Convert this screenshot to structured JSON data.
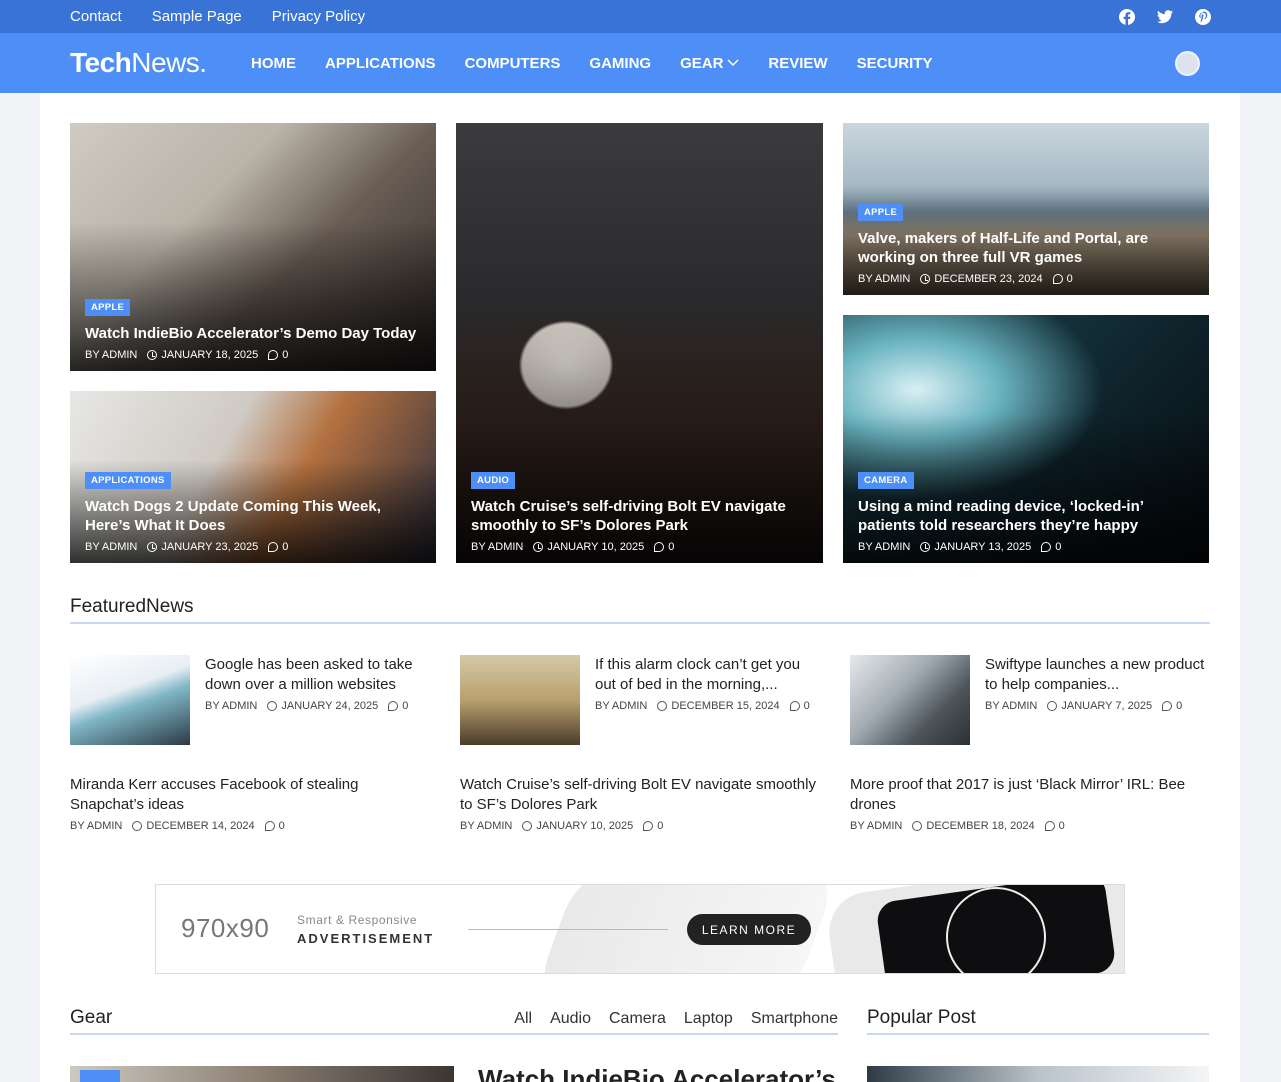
{
  "topbar": {
    "links": [
      "Contact",
      "Sample Page",
      "Privacy Policy"
    ],
    "social": [
      "facebook-icon",
      "twitter-icon",
      "pinterest-icon"
    ]
  },
  "nav": {
    "logo_bold": "Tech",
    "logo_light": "News.",
    "menu": [
      "HOME",
      "APPLICATIONS",
      "COMPUTERS",
      "GAMING",
      "GEAR",
      "REVIEW",
      "SECURITY"
    ]
  },
  "hero": [
    {
      "tag": "APPLE",
      "title": "Watch IndieBio Accelerator’s Demo Day Today",
      "author": "BY ADMIN",
      "date": "JANUARY 18, 2025",
      "comments": "0"
    },
    {
      "tag": "APPLICATIONS",
      "title": "Watch Dogs 2 Update Coming This Week, Here’s What It Does",
      "author": "BY ADMIN",
      "date": "JANUARY 23, 2025",
      "comments": "0"
    },
    {
      "tag": "AUDIO",
      "title": "Watch Cruise’s self-driving Bolt EV navigate smoothly to SF’s Dolores Park",
      "author": "BY ADMIN",
      "date": "JANUARY 10, 2025",
      "comments": "0"
    },
    {
      "tag": "APPLE",
      "title": "Valve, makers of Half-Life and Portal, are working on three full VR games",
      "author": "BY ADMIN",
      "date": "DECEMBER 23, 2024",
      "comments": "0"
    },
    {
      "tag": "CAMERA",
      "title": "Using a mind reading device, ‘locked-in’ patients told researchers they’re happy",
      "author": "BY ADMIN",
      "date": "JANUARY 13, 2025",
      "comments": "0"
    }
  ],
  "featured": {
    "heading": "FeaturedNews",
    "items": [
      {
        "title": "Google has been asked to take down over a million websites",
        "author": "BY ADMIN",
        "date": "JANUARY 24, 2025",
        "comments": "0"
      },
      {
        "title": "If this alarm clock can’t get you out of bed in the morning,...",
        "author": "BY ADMIN",
        "date": "DECEMBER 15, 2024",
        "comments": "0"
      },
      {
        "title": "Swiftype launches a new product to help companies...",
        "author": "BY ADMIN",
        "date": "JANUARY 7, 2025",
        "comments": "0"
      },
      {
        "title": "Miranda Kerr accuses Facebook of stealing Snapchat’s ideas",
        "author": "BY ADMIN",
        "date": "DECEMBER 14, 2024",
        "comments": "0"
      },
      {
        "title": "Watch Cruise’s self-driving Bolt EV navigate smoothly to SF’s Dolores Park",
        "author": "BY ADMIN",
        "date": "JANUARY 10, 2025",
        "comments": "0"
      },
      {
        "title": "More proof that 2017 is just ‘Black Mirror’ IRL: Bee drones",
        "author": "BY ADMIN",
        "date": "DECEMBER 18, 2024",
        "comments": "0"
      }
    ]
  },
  "ad": {
    "size": "970x90",
    "line1": "Smart & Responsive",
    "line2": "ADVERTISEMENT",
    "button": "LEARN MORE"
  },
  "gear": {
    "heading": "Gear",
    "tabs": [
      "All",
      "Audio",
      "Camera",
      "Laptop",
      "Smartphone"
    ],
    "first_title": "Watch IndieBio Accelerator’s"
  },
  "popular": {
    "heading": "Popular Post"
  },
  "colors": {
    "topbar": "#3a73d6",
    "navbar": "#4d8ef7",
    "accent": "#4d8ef7"
  }
}
